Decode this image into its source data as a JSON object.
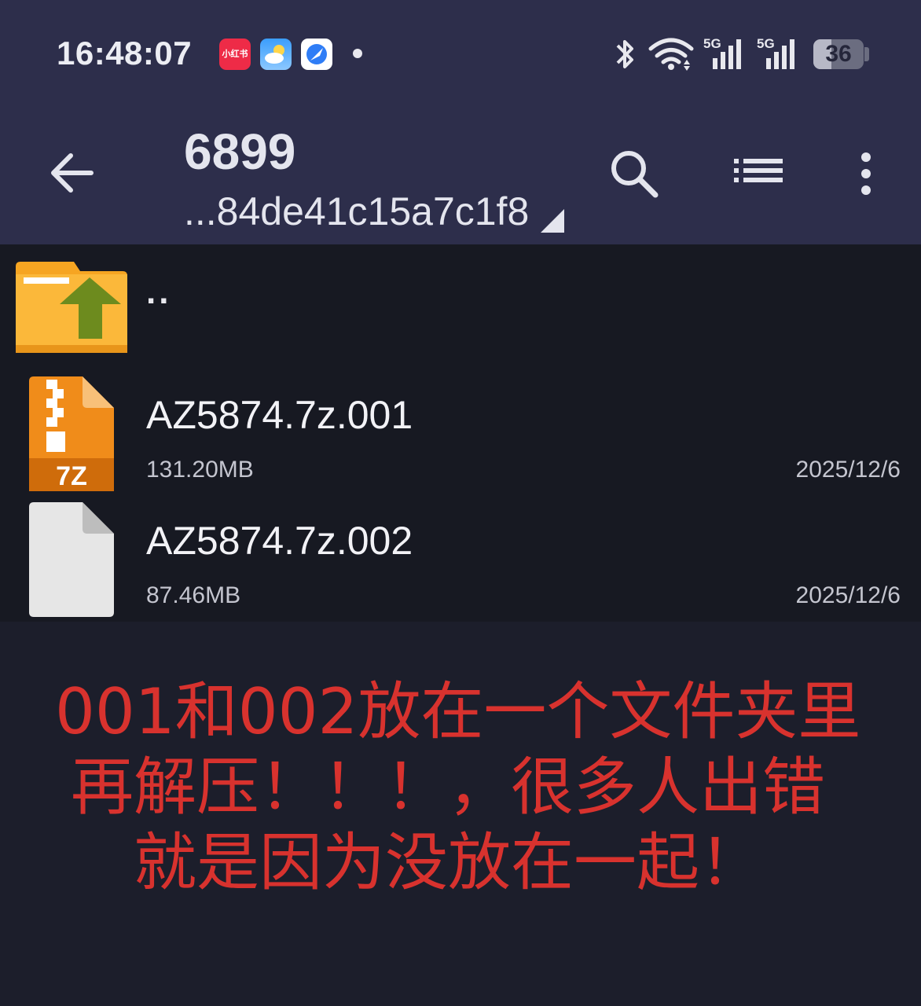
{
  "status_bar": {
    "time": "16:48:07",
    "notification_apps": [
      "xiaohongshu-app-icon",
      "weather-app-icon",
      "browser-app-icon"
    ],
    "xiaohongshu_label": "小红书",
    "network_1": "5G",
    "network_2": "5G",
    "battery_level": "36"
  },
  "app_bar": {
    "title": "6899",
    "path": "...84de41c15a7c1f8"
  },
  "files": [
    {
      "name": "..",
      "type": "parent-folder"
    },
    {
      "name": "AZ5874.7z.001",
      "size": "131.20MB",
      "date": "2025/12/6",
      "type": "7z-archive",
      "icon_label": "7Z"
    },
    {
      "name": "AZ5874.7z.002",
      "size": "87.46MB",
      "date": "2025/12/6",
      "type": "generic-file"
    }
  ],
  "notice": {
    "line1": "001和002放在一个文件夹里",
    "line2": "再解压！！！，很多人出错",
    "line3": "就是因为没放在一起！"
  },
  "colors": {
    "header_bg": "#2d2e4b",
    "list_bg": "#171922",
    "page_bg": "#1c1e2b",
    "folder": "#f5a623",
    "archive": "#f08c1a",
    "notice_text": "#d8322e"
  }
}
